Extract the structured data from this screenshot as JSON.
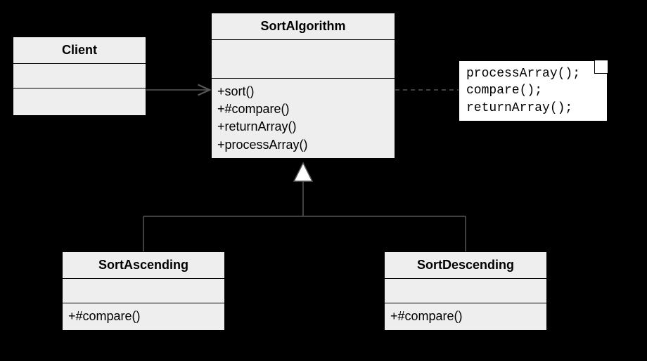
{
  "classes": {
    "client": {
      "name": "Client",
      "ops": []
    },
    "sortAlgorithm": {
      "name": "SortAlgorithm",
      "ops": [
        "+sort()",
        "+#compare()",
        "+returnArray()",
        "+processArray()"
      ]
    },
    "sortAscending": {
      "name": "SortAscending",
      "ops": [
        "+#compare()"
      ]
    },
    "sortDescending": {
      "name": "SortDescending",
      "ops": [
        "+#compare()"
      ]
    }
  },
  "note": {
    "lines": [
      "processArray();",
      "compare();",
      "returnArray();"
    ]
  },
  "relations": {
    "clientToAlgo": "association-arrow",
    "algoToNote": "dashed-anchor",
    "ascToAlgo": "generalization",
    "descToAlgo": "generalization"
  }
}
